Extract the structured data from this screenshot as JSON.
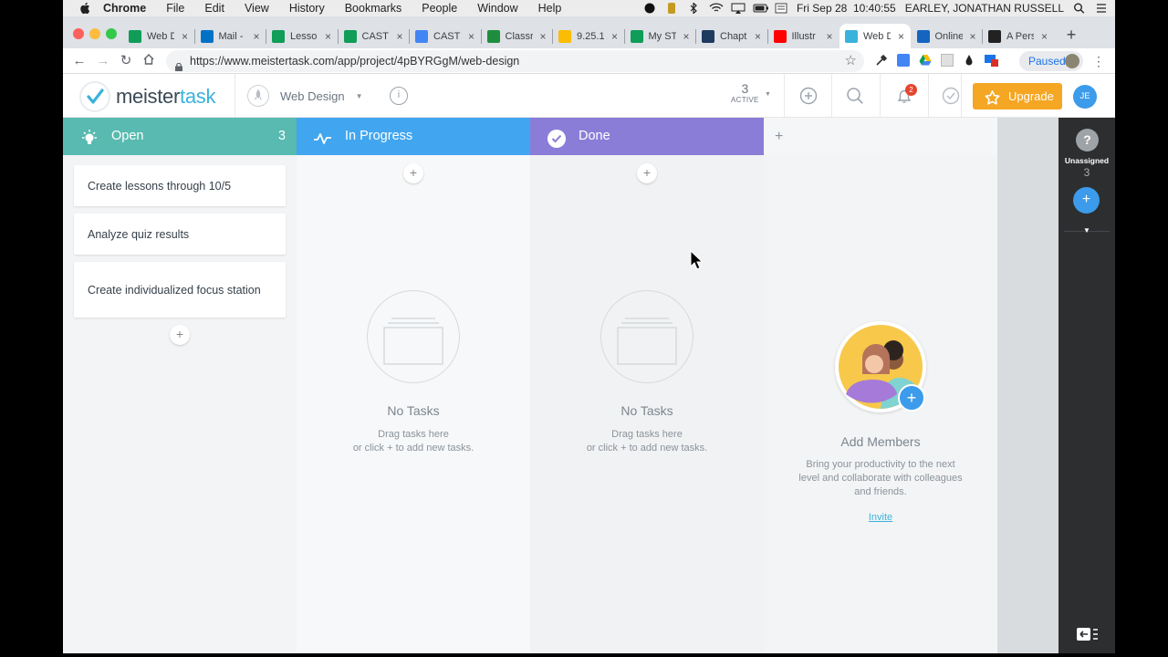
{
  "menubar": {
    "app": "Chrome",
    "items": [
      "File",
      "Edit",
      "View",
      "History",
      "Bookmarks",
      "People",
      "Window",
      "Help"
    ],
    "clock": "Fri Sep 28  10:40:55",
    "user": "EARLEY, JONATHAN RUSSELL"
  },
  "tabs": [
    {
      "title": "Web D",
      "color": "#0f9d58"
    },
    {
      "title": "Mail -",
      "color": "#0072c6"
    },
    {
      "title": "Lesso",
      "color": "#0f9d58"
    },
    {
      "title": "CAST",
      "color": "#0f9d58"
    },
    {
      "title": "CAST",
      "color": "#4285f4"
    },
    {
      "title": "Classr",
      "color": "#1e8e3e"
    },
    {
      "title": "9.25.1",
      "color": "#fbbc04"
    },
    {
      "title": "My ST",
      "color": "#0f9d58"
    },
    {
      "title": "Chapt",
      "color": "#1f3a5f"
    },
    {
      "title": "Illustr",
      "color": "#ff0000"
    },
    {
      "title": "Web D",
      "color": "#3ab3dc"
    },
    {
      "title": "Online",
      "color": "#1565c0"
    },
    {
      "title": "A Pers",
      "color": "#222222"
    }
  ],
  "active_tab_index": 10,
  "address": {
    "url": "https://www.meistertask.com/app/project/4pBYRGgM/web-design"
  },
  "profile": {
    "label": "Paused"
  },
  "app": {
    "logo_a": "meister",
    "logo_b": "task",
    "project": "Web Design",
    "info": "i",
    "active_count": "3",
    "active_label": "ACTIVE",
    "notifications": "2",
    "upgrade": "Upgrade",
    "avatar": "JE"
  },
  "columns": [
    {
      "name": "Open",
      "count": "3",
      "color": "#58bab0"
    },
    {
      "name": "In Progress",
      "count": "",
      "color": "#41a6ef"
    },
    {
      "name": "Done",
      "count": "",
      "color": "#8a7dd8"
    }
  ],
  "open_tasks": [
    "Create lessons through 10/5",
    "Analyze quiz results",
    "Create individualized focus station"
  ],
  "empty": {
    "title": "No Tasks",
    "hint_1": "Drag tasks here",
    "hint_2": "or click + to add new tasks."
  },
  "add_symbol": "+",
  "members": {
    "title": "Add Members",
    "text_1": "Bring your productivity to the next",
    "text_2": "level and collaborate with colleagues",
    "text_3": "and friends.",
    "invite": "Invite"
  },
  "sidebar": {
    "help": "?",
    "label": "Unassigned",
    "count": "3"
  }
}
